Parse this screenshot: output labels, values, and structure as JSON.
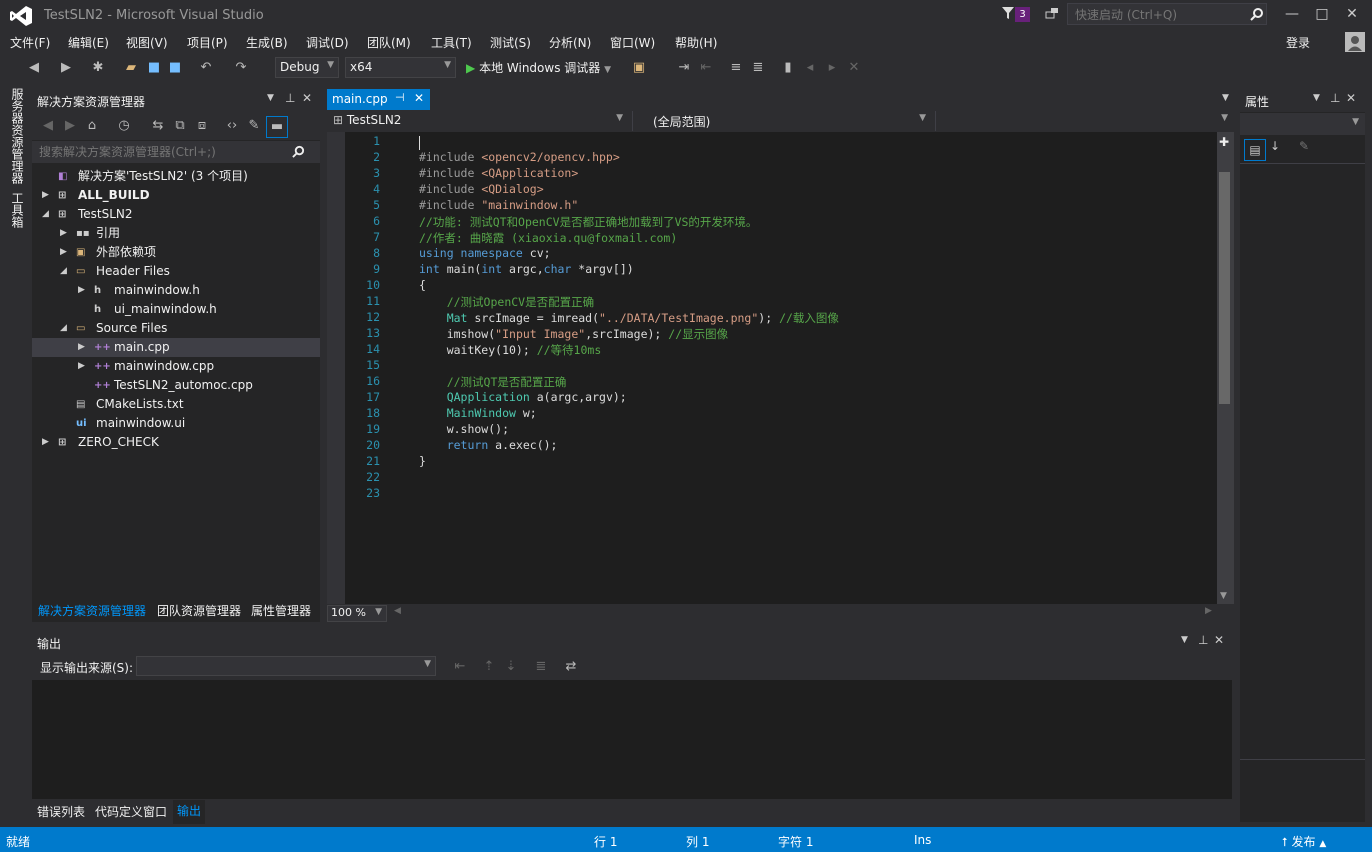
{
  "window": {
    "title": "TestSLN2 - Microsoft Visual Studio",
    "notification_count": "3",
    "quick_launch_placeholder": "快速启动 (Ctrl+Q)"
  },
  "menu": [
    "文件(F)",
    "编辑(E)",
    "视图(V)",
    "项目(P)",
    "生成(B)",
    "调试(D)",
    "团队(M)",
    "工具(T)",
    "测试(S)",
    "分析(N)",
    "窗口(W)",
    "帮助(H)"
  ],
  "account": {
    "login_label": "登录"
  },
  "toolbar": {
    "configuration": "Debug",
    "platform": "x64",
    "run_label": "本地 Windows 调试器"
  },
  "left_tabs": [
    "服务器资源管理器",
    "工具箱"
  ],
  "solution_explorer": {
    "title": "解决方案资源管理器",
    "search_placeholder": "搜索解决方案资源管理器(Ctrl+;)",
    "tree": [
      {
        "label": "解决方案'TestSLN2' (3 个项目)",
        "level": 0,
        "twisty": "",
        "icon": "solution-icon",
        "bold": false,
        "selected": false
      },
      {
        "label": "ALL_BUILD",
        "level": 0,
        "twisty": "▶",
        "icon": "project-icon",
        "bold": true,
        "selected": false
      },
      {
        "label": "TestSLN2",
        "level": 0,
        "twisty": "◢",
        "icon": "project-icon",
        "bold": false,
        "selected": false
      },
      {
        "label": "引用",
        "level": 1,
        "twisty": "▶",
        "icon": "references-icon",
        "bold": false,
        "selected": false
      },
      {
        "label": "外部依赖项",
        "level": 1,
        "twisty": "▶",
        "icon": "external-deps-icon",
        "bold": false,
        "selected": false
      },
      {
        "label": "Header Files",
        "level": 1,
        "twisty": "◢",
        "icon": "folder-icon",
        "bold": false,
        "selected": false
      },
      {
        "label": "mainwindow.h",
        "level": 2,
        "twisty": "▶",
        "icon": "header-file-icon",
        "bold": false,
        "selected": false
      },
      {
        "label": "ui_mainwindow.h",
        "level": 2,
        "twisty": "",
        "icon": "header-file-icon",
        "bold": false,
        "selected": false
      },
      {
        "label": "Source Files",
        "level": 1,
        "twisty": "◢",
        "icon": "folder-icon",
        "bold": false,
        "selected": false
      },
      {
        "label": "main.cpp",
        "level": 2,
        "twisty": "▶",
        "icon": "cpp-file-icon",
        "bold": false,
        "selected": true
      },
      {
        "label": "mainwindow.cpp",
        "level": 2,
        "twisty": "▶",
        "icon": "cpp-file-icon",
        "bold": false,
        "selected": false
      },
      {
        "label": "TestSLN2_automoc.cpp",
        "level": 2,
        "twisty": "",
        "icon": "cpp-file-icon",
        "bold": false,
        "selected": false
      },
      {
        "label": "CMakeLists.txt",
        "level": 1,
        "twisty": "",
        "icon": "text-file-icon",
        "bold": false,
        "selected": false
      },
      {
        "label": "mainwindow.ui",
        "level": 1,
        "twisty": "",
        "icon": "ui-file-icon",
        "bold": false,
        "selected": false
      },
      {
        "label": "ZERO_CHECK",
        "level": 0,
        "twisty": "▶",
        "icon": "project-icon",
        "bold": false,
        "selected": false
      }
    ],
    "bottom_tabs": [
      "解决方案资源管理器",
      "团队资源管理器",
      "属性管理器"
    ]
  },
  "editor": {
    "tab_label": "main.cpp",
    "nav_project": "TestSLN2",
    "nav_scope": "(全局范围)",
    "zoom": "100 %",
    "line_numbers": [
      "1",
      "2",
      "3",
      "4",
      "5",
      "6",
      "7",
      "8",
      "9",
      "10",
      "11",
      "12",
      "13",
      "14",
      "15",
      "16",
      "17",
      "18",
      "19",
      "20",
      "21",
      "22",
      "23"
    ],
    "lines": [
      [],
      [
        [
          "pp",
          "#include "
        ],
        [
          "str",
          "<opencv2/opencv.hpp>"
        ]
      ],
      [
        [
          "pp",
          "#include "
        ],
        [
          "str",
          "<QApplication>"
        ]
      ],
      [
        [
          "pp",
          "#include "
        ],
        [
          "str",
          "<QDialog>"
        ]
      ],
      [
        [
          "pp",
          "#include "
        ],
        [
          "str",
          "\"mainwindow.h\""
        ]
      ],
      [
        [
          "cm",
          "//功能: 测试QT和OpenCV是否都正确地加载到了VS的开发环境。"
        ]
      ],
      [
        [
          "cm",
          "//作者: 曲晓霞 (xiaoxia.qu@foxmail.com)"
        ]
      ],
      [
        [
          "kw",
          "using namespace "
        ],
        [
          "",
          "cv;"
        ]
      ],
      [
        [
          "kw",
          "int "
        ],
        [
          "",
          "main("
        ],
        [
          "kw",
          "int "
        ],
        [
          "",
          "argc,"
        ],
        [
          "kw",
          "char "
        ],
        [
          "",
          "*argv[])"
        ]
      ],
      [
        [
          "",
          "{"
        ]
      ],
      [
        [
          "",
          "    "
        ],
        [
          "cm",
          "//测试OpenCV是否配置正确"
        ]
      ],
      [
        [
          "",
          "    "
        ],
        [
          "ty",
          "Mat "
        ],
        [
          "",
          "srcImage = imread("
        ],
        [
          "str",
          "\"../DATA/TestImage.png\""
        ],
        [
          "",
          "); "
        ],
        [
          "cm",
          "//载入图像"
        ]
      ],
      [
        [
          "",
          "    imshow("
        ],
        [
          "str",
          "\"Input Image\""
        ],
        [
          "",
          ",srcImage); "
        ],
        [
          "cm",
          "//显示图像"
        ]
      ],
      [
        [
          "",
          "    waitKey(10); "
        ],
        [
          "cm",
          "//等待10ms"
        ]
      ],
      [],
      [
        [
          "",
          "    "
        ],
        [
          "cm",
          "//测试QT是否配置正确"
        ]
      ],
      [
        [
          "",
          "    "
        ],
        [
          "ty",
          "QApplication "
        ],
        [
          "",
          "a(argc,argv);"
        ]
      ],
      [
        [
          "",
          "    "
        ],
        [
          "ty",
          "MainWindow "
        ],
        [
          "",
          "w;"
        ]
      ],
      [
        [
          "",
          "    w.show();"
        ]
      ],
      [
        [
          "",
          "    "
        ],
        [
          "kw",
          "return "
        ],
        [
          "",
          "a.exec();"
        ]
      ],
      [
        [
          "",
          "}"
        ]
      ],
      [],
      []
    ]
  },
  "properties": {
    "title": "属性"
  },
  "output": {
    "title": "输出",
    "source_label": "显示输出来源(S):",
    "source_value": ""
  },
  "bottom_tabs": [
    "错误列表",
    "代码定义窗口",
    "输出"
  ],
  "status": {
    "state": "就绪",
    "line": "行 1",
    "col": "列 1",
    "char": "字符 1",
    "mode": "Ins",
    "publish": "发布"
  },
  "colors": {
    "accent": "#007acc",
    "background": "#2d2d30",
    "editor": "#1e1e1e"
  }
}
